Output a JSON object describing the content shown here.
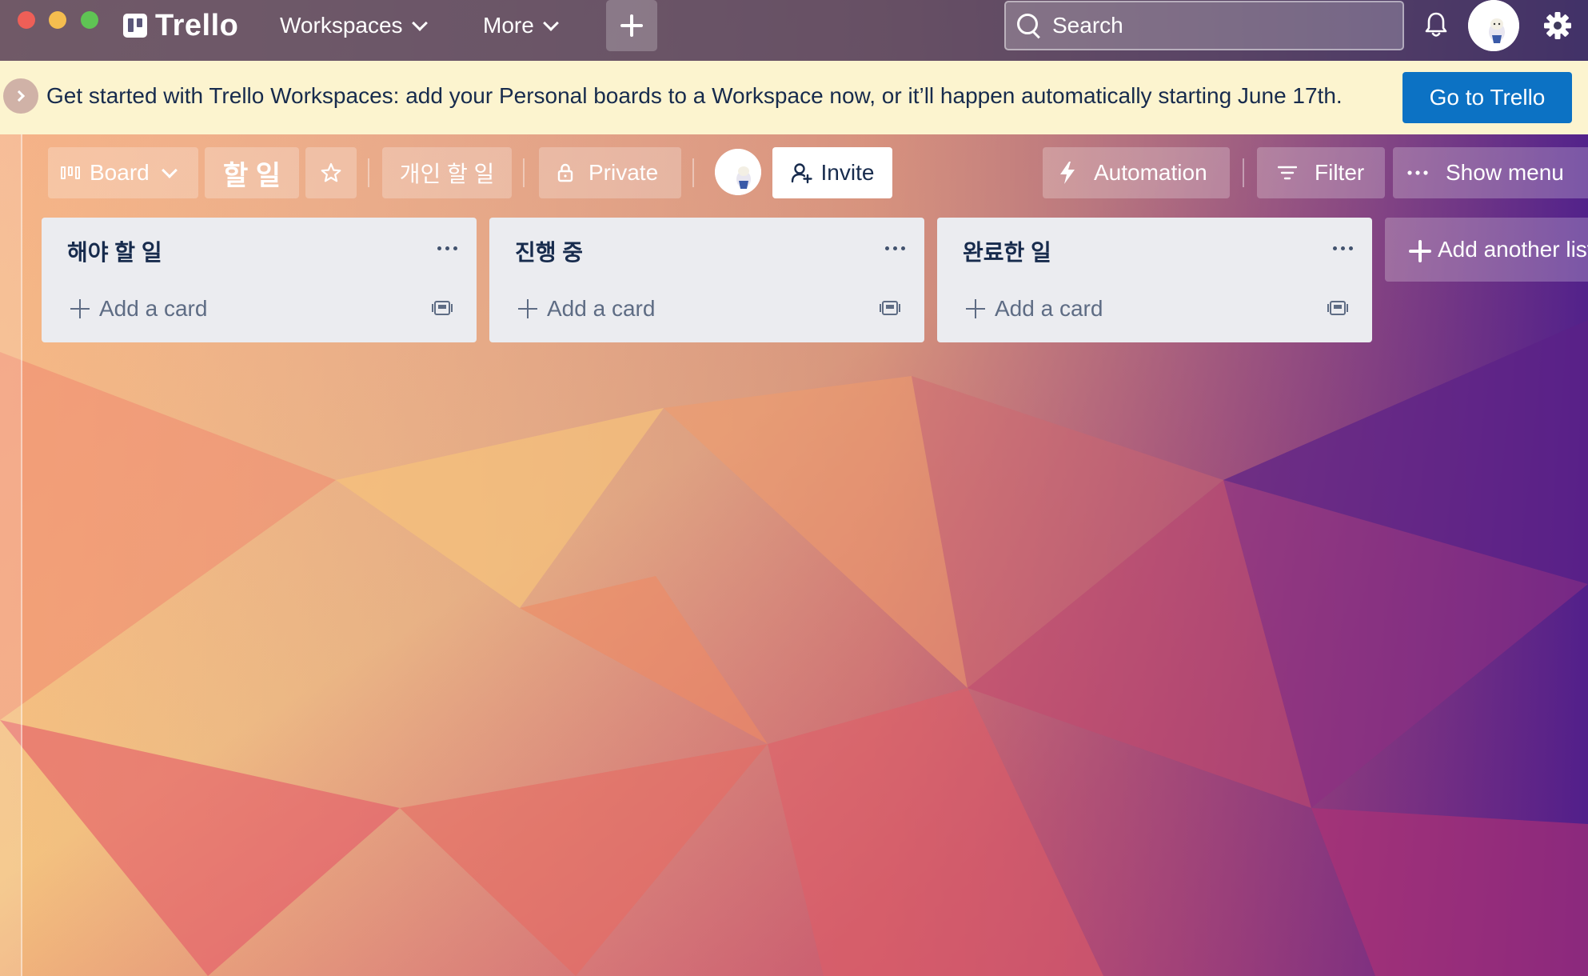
{
  "window": {
    "title": "Trello"
  },
  "topbar": {
    "logo_text": "Trello",
    "workspaces_label": "Workspaces",
    "more_label": "More",
    "search_placeholder": "Search",
    "icons": [
      "trello-logo-icon",
      "plus-icon",
      "search-icon",
      "bell-icon",
      "avatar",
      "gear-icon"
    ]
  },
  "banner": {
    "message": "Get started with Trello Workspaces: add your Personal boards to a Workspace now, or it’ll happen automatically starting June 17th.",
    "button_label": "Go to Trello"
  },
  "board_header": {
    "view_label": "Board",
    "board_name": "할 일",
    "workspace_label": "개인 할 일",
    "visibility_label": "Private",
    "invite_label": "Invite",
    "automation_label": "Automation",
    "filter_label": "Filter",
    "show_menu_label": "Show menu"
  },
  "lists": [
    {
      "title": "해야 할 일",
      "add_card_label": "Add a card"
    },
    {
      "title": "진행 중",
      "add_card_label": "Add a card"
    },
    {
      "title": "완료한 일",
      "add_card_label": "Add a card"
    }
  ],
  "add_list_label": "Add another list",
  "colors": {
    "banner_bg": "#fcf4cf",
    "banner_button": "#0c72c4",
    "list_bg": "#ebecf0",
    "text_dark": "#172b4d"
  }
}
